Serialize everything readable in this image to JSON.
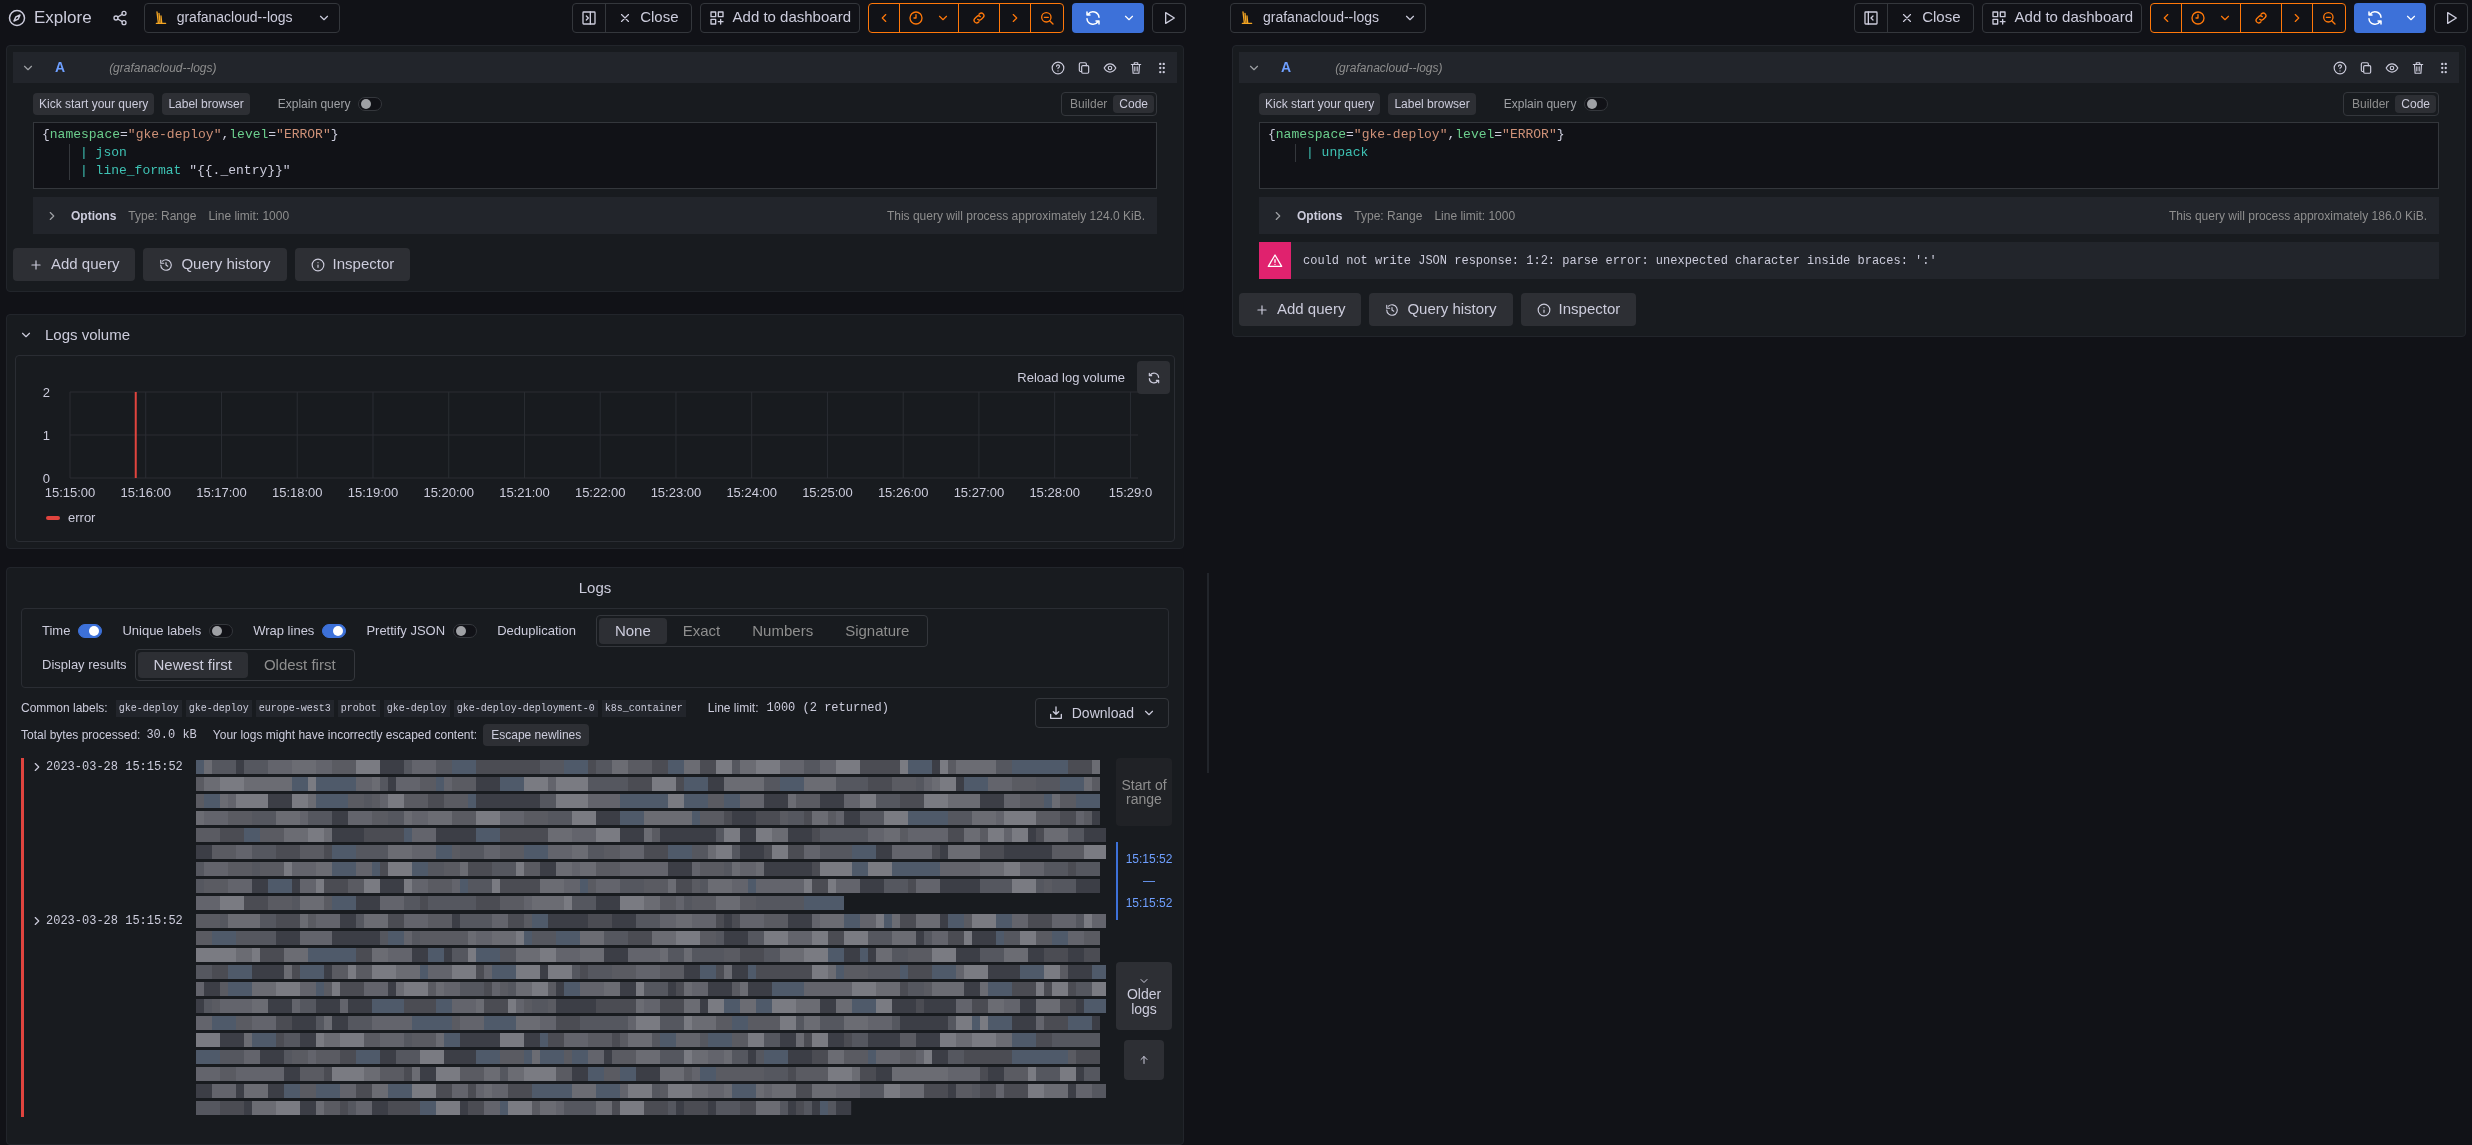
{
  "panes": [
    {
      "title": "Explore",
      "datasource": "grafanacloud--logs",
      "toolbar": {
        "close": "Close",
        "add": "Add to dashboard"
      },
      "query": {
        "letter": "A",
        "source": "(grafanacloud--logs)",
        "expanded": true,
        "buttons": [
          "Kick start your query",
          "Label browser"
        ],
        "explain": {
          "label": "Explain query",
          "on": false
        },
        "modes": [
          {
            "label": "Builder",
            "selected": false
          },
          {
            "label": "Code",
            "selected": true
          }
        ],
        "lines": [
          {
            "indented": false,
            "tokens": [
              {
                "text": "{",
                "kind": "punct"
              },
              {
                "text": "namespace",
                "kind": "label"
              },
              {
                "text": "=",
                "kind": "punct"
              },
              {
                "text": "\"gke-deploy\"",
                "kind": "string"
              },
              {
                "text": ",",
                "kind": "punct"
              },
              {
                "text": "level",
                "kind": "label"
              },
              {
                "text": "=",
                "kind": "punct"
              },
              {
                "text": "\"ERROR\"",
                "kind": "string"
              },
              {
                "text": "}",
                "kind": "punct"
              }
            ]
          },
          {
            "indented": true,
            "tokens": [
              {
                "text": "| json",
                "kind": "keyword"
              }
            ]
          },
          {
            "indented": true,
            "tokens": [
              {
                "text": "| line_format ",
                "kind": "keyword"
              },
              {
                "text": "\"{{._entry}}\"",
                "kind": "punct"
              }
            ]
          }
        ],
        "options": {
          "label": "Options",
          "expanded": false,
          "type": "Type: Range",
          "limit": "Line limit: 1000",
          "estimate": "This query will process approximately 124.0 KiB."
        }
      },
      "actions": [
        "Add query",
        "Query history",
        "Inspector"
      ],
      "logs_volume": {
        "title": "Logs volume",
        "expanded": true,
        "reload": "Reload log volume",
        "chart_data": {
          "type": "bar",
          "categories": [
            "15:15:00",
            "15:16:00",
            "15:17:00",
            "15:18:00",
            "15:19:00",
            "15:20:00",
            "15:21:00",
            "15:22:00",
            "15:23:00",
            "15:24:00",
            "15:25:00",
            "15:26:00",
            "15:27:00",
            "15:28:00",
            "15:29:0"
          ],
          "series": [
            {
              "name": "error",
              "color": "#e0443e",
              "values": [
                null,
                2,
                null,
                null,
                null,
                null,
                null,
                null,
                null,
                null,
                null,
                null,
                null,
                null,
                null
              ]
            }
          ],
          "ylim": [
            0,
            2
          ],
          "yticks": [
            0,
            1,
            2
          ],
          "grid": true
        }
      },
      "logs": {
        "title": "Logs",
        "toggles": [
          {
            "label": "Time",
            "on": true
          },
          {
            "label": "Unique labels",
            "on": false
          },
          {
            "label": "Wrap lines",
            "on": true
          },
          {
            "label": "Prettify JSON",
            "on": false
          }
        ],
        "dedup": {
          "label": "Deduplication",
          "options": [
            {
              "label": "None",
              "selected": true
            },
            {
              "label": "Exact",
              "selected": false
            },
            {
              "label": "Numbers",
              "selected": false
            },
            {
              "label": "Signature",
              "selected": false
            }
          ]
        },
        "order": {
          "label": "Display results",
          "options": [
            {
              "label": "Newest first",
              "selected": true
            },
            {
              "label": "Oldest first",
              "selected": false
            }
          ]
        },
        "common_labels": {
          "label": "Common labels:",
          "values": [
            "gke-deploy",
            "gke-deploy",
            "europe-west3",
            "probot",
            "gke-deploy",
            "gke-deploy-deployment-0",
            "k8s_container"
          ]
        },
        "line_limit": {
          "label": "Line limit:",
          "value": "1000 (2 returned)"
        },
        "bytes": {
          "label": "Total bytes processed:",
          "value": "30.0 kB"
        },
        "escape": {
          "message": "Your logs might have incorrectly escaped content:",
          "button": "Escape newlines"
        },
        "download": "Download",
        "rows": [
          {
            "time": "2023-03-28 15:15:52",
            "color": "#e0443e",
            "expanded": false
          },
          {
            "time": "2023-03-28 15:15:52",
            "color": "#e0443e",
            "expanded": false
          }
        ],
        "navigation": {
          "start": "Start of range",
          "from": "15:15:52",
          "separator": "—",
          "to": "15:15:52",
          "older": "Older logs"
        }
      }
    },
    {
      "datasource": "grafanacloud--logs",
      "toolbar": {
        "close": "Close",
        "add": "Add to dashboard"
      },
      "query": {
        "letter": "A",
        "source": "(grafanacloud--logs)",
        "expanded": true,
        "buttons": [
          "Kick start your query",
          "Label browser"
        ],
        "explain": {
          "label": "Explain query",
          "on": false
        },
        "modes": [
          {
            "label": "Builder",
            "selected": false
          },
          {
            "label": "Code",
            "selected": true
          }
        ],
        "lines": [
          {
            "indented": false,
            "tokens": [
              {
                "text": "{",
                "kind": "punct"
              },
              {
                "text": "namespace",
                "kind": "label"
              },
              {
                "text": "=",
                "kind": "punct"
              },
              {
                "text": "\"gke-deploy\"",
                "kind": "string"
              },
              {
                "text": ",",
                "kind": "punct"
              },
              {
                "text": "level",
                "kind": "label"
              },
              {
                "text": "=",
                "kind": "punct"
              },
              {
                "text": "\"ERROR\"",
                "kind": "string"
              },
              {
                "text": "}",
                "kind": "punct"
              }
            ]
          },
          {
            "indented": true,
            "tokens": [
              {
                "text": "| unpack",
                "kind": "keyword"
              }
            ]
          }
        ],
        "options": {
          "label": "Options",
          "expanded": false,
          "type": "Type: Range",
          "limit": "Line limit: 1000",
          "estimate": "This query will process approximately 186.0 KiB."
        },
        "error": "could not write JSON response: 1:2: parse error: unexpected character inside braces: ':'"
      },
      "actions": [
        "Add query",
        "Query history",
        "Inspector"
      ]
    }
  ]
}
